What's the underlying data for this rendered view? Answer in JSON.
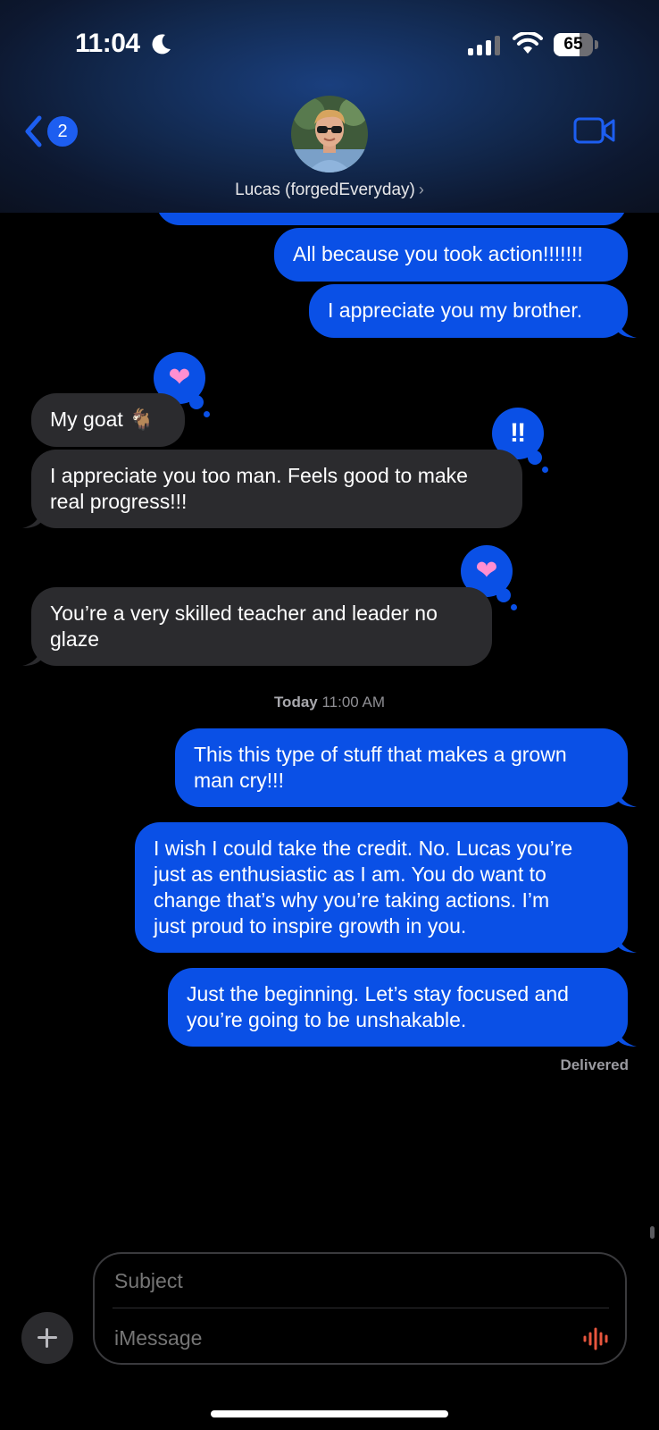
{
  "status_bar": {
    "time": "11:04",
    "battery": "65",
    "battery_level": 0.65,
    "icons": [
      "moon-icon",
      "signal-icon",
      "wifi-icon",
      "battery-icon"
    ]
  },
  "header": {
    "back_badge": "2",
    "contact_name": "Lucas (forgedEveryday)",
    "chevron": "›",
    "icons": [
      "back-chevron-icon",
      "video-call-icon"
    ]
  },
  "colors": {
    "sent_bubble": "#0a50e6",
    "received_bubble": "#2b2b2e",
    "background": "#000000",
    "accent": "#1d5ef0",
    "audio_icon": "#e8563e"
  },
  "messages": [
    {
      "from": "me",
      "text": "All because you took action!!!!!!!"
    },
    {
      "from": "me",
      "text": "I appreciate you my brother."
    },
    {
      "from": "them",
      "text": "My goat 🐐",
      "tapback": "❤"
    },
    {
      "from": "them",
      "text": "I appreciate you too man. Feels good to make\nreal progress!!!",
      "tapback": "‼"
    },
    {
      "from": "them",
      "text": "You’re a very skilled teacher and leader no\nglaze",
      "tapback": "❤"
    },
    {
      "from": "me",
      "text": "This this type of stuff that makes a grown\nman cry!!!"
    },
    {
      "from": "me",
      "text": "I wish I could take the credit. No. Lucas you’re\njust as enthusiastic as I am. You do want to\nchange that’s why you’re taking actions. I’m\njust proud to inspire growth in you."
    },
    {
      "from": "me",
      "text": "Just the beginning. Let’s stay focused and\nyou’re going to be unshakable."
    }
  ],
  "timestamp": {
    "day": "Today",
    "time": "11:00 AM"
  },
  "delivered": "Delivered",
  "composer": {
    "subject_placeholder": "Subject",
    "message_placeholder": "iMessage"
  }
}
